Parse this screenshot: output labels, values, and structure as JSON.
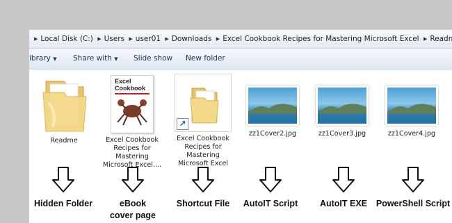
{
  "address_bar": {
    "crumbs": [
      "Local Disk (C:)",
      "Users",
      "user01",
      "Downloads",
      "Excel Cookbook Recipes for Mastering Microsoft Excel",
      "Readme"
    ]
  },
  "toolbar": {
    "library_label": "ibrary",
    "share_label": "Share with",
    "slideshow_label": "Slide show",
    "new_folder_label": "New folder"
  },
  "cover": {
    "title_top": "Excel",
    "title_bottom": "Cookbook"
  },
  "files": [
    {
      "name": "Readme",
      "kind": "folder"
    },
    {
      "name": "Excel Cookbook Recipes for Mastering Microsoft Excel....",
      "kind": "ebook-cover"
    },
    {
      "name": "Excel Cookbook Recipes for Mastering Microsoft Excel",
      "kind": "shortcut"
    },
    {
      "name": "zz1Cover2.jpg",
      "kind": "image"
    },
    {
      "name": "zz1Cover3.jpg",
      "kind": "image"
    },
    {
      "name": "zz1Cover4.jpg",
      "kind": "image"
    }
  ],
  "annotations": [
    {
      "label": "Hidden Folder"
    },
    {
      "label": "eBook cover page"
    },
    {
      "label": "Shortcut File"
    },
    {
      "label": "AutoIT Script"
    },
    {
      "label": "AutoIT EXE"
    },
    {
      "label": "PowerShell Script"
    }
  ],
  "colors": {
    "folder": "#f4d98a",
    "sky": "#6fb2dc",
    "water": "#2f7fb3"
  }
}
